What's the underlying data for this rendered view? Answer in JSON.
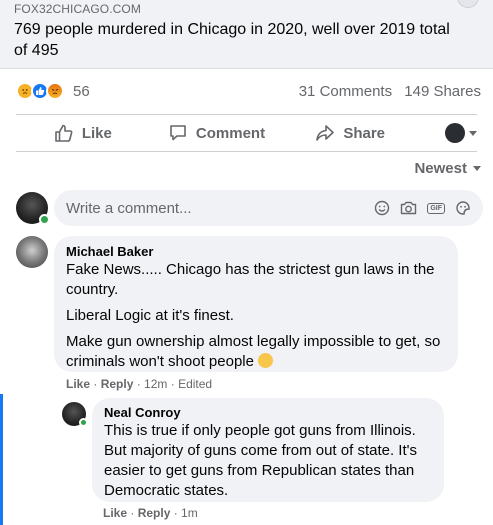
{
  "post": {
    "link_domain": "FOX32CHICAGO.COM",
    "link_title": "769 people murdered in Chicago in 2020, well over 2019 total of 495"
  },
  "stats": {
    "reaction_icons": [
      "sad-reaction-icon",
      "like-reaction-icon",
      "angry-reaction-icon"
    ],
    "reaction_count": "56",
    "comments": "31 Comments",
    "shares": "149 Shares"
  },
  "actions": {
    "like": "Like",
    "comment": "Comment",
    "share": "Share"
  },
  "sort": {
    "label": "Newest"
  },
  "composer": {
    "placeholder": "Write a comment..."
  },
  "comments": [
    {
      "author": "Michael Baker",
      "paragraphs": [
        "Fake News..... Chicago has the strictest gun laws in the country.",
        "Liberal Logic at it's finest.",
        "Make gun ownership almost legally impossible to get, so criminals won't shoot people"
      ],
      "like": "Like",
      "reply": "Reply",
      "time": "12m",
      "edited": "Edited"
    },
    {
      "author": "Neal Conroy",
      "paragraphs": [
        "This is true if only people got guns from Illinois. But majority of guns come from out of state. It's easier to get guns from Republican states than Democratic states."
      ],
      "like": "Like",
      "reply": "Reply",
      "time": "1m"
    }
  ],
  "colors": {
    "accent": "#1877f2",
    "bubble": "#f0f2f5",
    "secondary_text": "#65676b",
    "online": "#31a24c"
  }
}
